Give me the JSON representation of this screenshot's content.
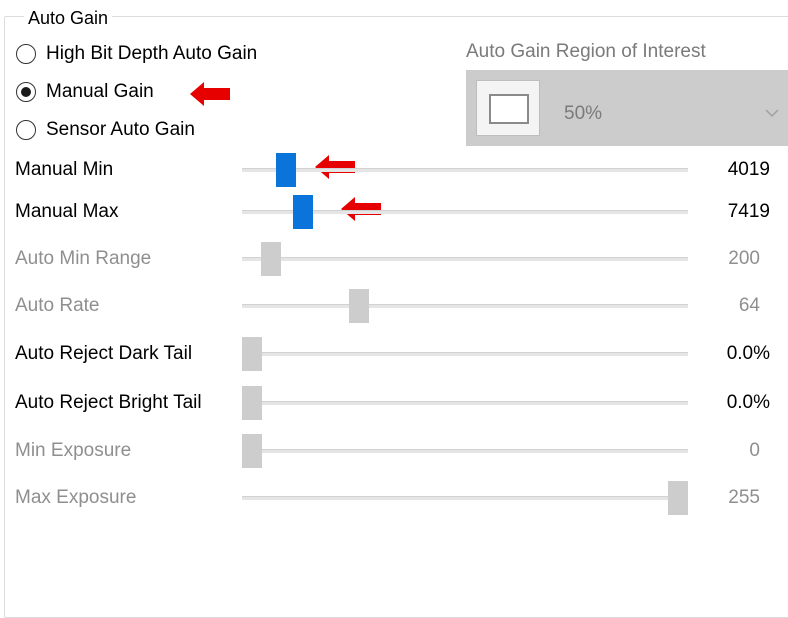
{
  "group": {
    "title": "Auto Gain"
  },
  "gain_modes": [
    {
      "label": "High Bit Depth Auto Gain",
      "selected": false
    },
    {
      "label": "Manual Gain",
      "selected": true
    },
    {
      "label": "Sensor Auto Gain",
      "selected": false
    }
  ],
  "roi": {
    "label": "Auto Gain Region of Interest",
    "value": "50%",
    "icon": "roi-rectangle-icon",
    "chevron_icon": "chevron-down-icon"
  },
  "sliders": [
    {
      "label": "Manual Min",
      "value_text": "4019",
      "enabled": true,
      "fraction": 0.08
    },
    {
      "label": "Manual Max",
      "value_text": "7419",
      "enabled": true,
      "fraction": 0.12
    },
    {
      "label": "Auto Min Range",
      "value_text": "200",
      "enabled": false,
      "fraction": 0.045
    },
    {
      "label": "Auto Rate",
      "value_text": "64",
      "enabled": false,
      "fraction": 0.25
    },
    {
      "label": "Auto Reject Dark Tail",
      "value_text": "0.0%",
      "enabled": true,
      "fraction": 0.0
    },
    {
      "label": "Auto Reject Bright Tail",
      "value_text": "0.0%",
      "enabled": true,
      "fraction": 0.0
    },
    {
      "label": "Min Exposure",
      "value_text": "0",
      "enabled": false,
      "fraction": 0.0
    },
    {
      "label": "Max Exposure",
      "value_text": "255",
      "enabled": false,
      "fraction": 1.0
    }
  ],
  "annotation": {
    "arrow_color": "#e60000",
    "arrow_icon": "red-arrow-left-icon"
  },
  "colors": {
    "thumb_active": "#0a74da",
    "thumb_disabled": "#cdcdcd",
    "disabled_text": "#8f8f8f"
  }
}
